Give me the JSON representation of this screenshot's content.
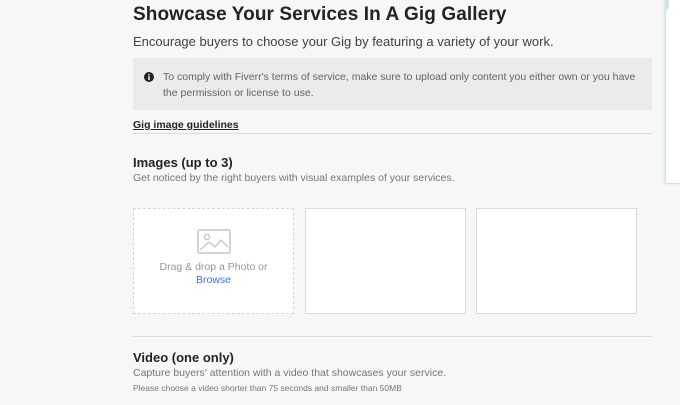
{
  "header": {
    "title": "Showcase Your Services In A Gig Gallery",
    "subtitle": "Encourage buyers to choose your Gig by featuring a variety of your work."
  },
  "notice": {
    "icon": "info-icon",
    "text": "To comply with Fiverr's terms of service, make sure to upload only content you either own or you have the permission or license to use."
  },
  "guidelines_link": "Gig image guidelines",
  "images_section": {
    "title": "Images (up to 3)",
    "description": "Get noticed by the right buyers with visual examples of your services.",
    "upload_slot": {
      "icon": "photo-icon",
      "drop_text": "Drag & drop a Photo or",
      "browse_label": "Browse"
    }
  },
  "video_section": {
    "title": "Video (one only)",
    "description": "Capture buyers' attention with a video that showcases your service.",
    "note": "Please choose a video shorter than 75 seconds and smaller than 50MB"
  },
  "colors": {
    "background": "#f7f7f7",
    "link": "#446ee7",
    "notice_bg": "#ebebeb",
    "title": "#222325",
    "muted": "#74767e"
  }
}
